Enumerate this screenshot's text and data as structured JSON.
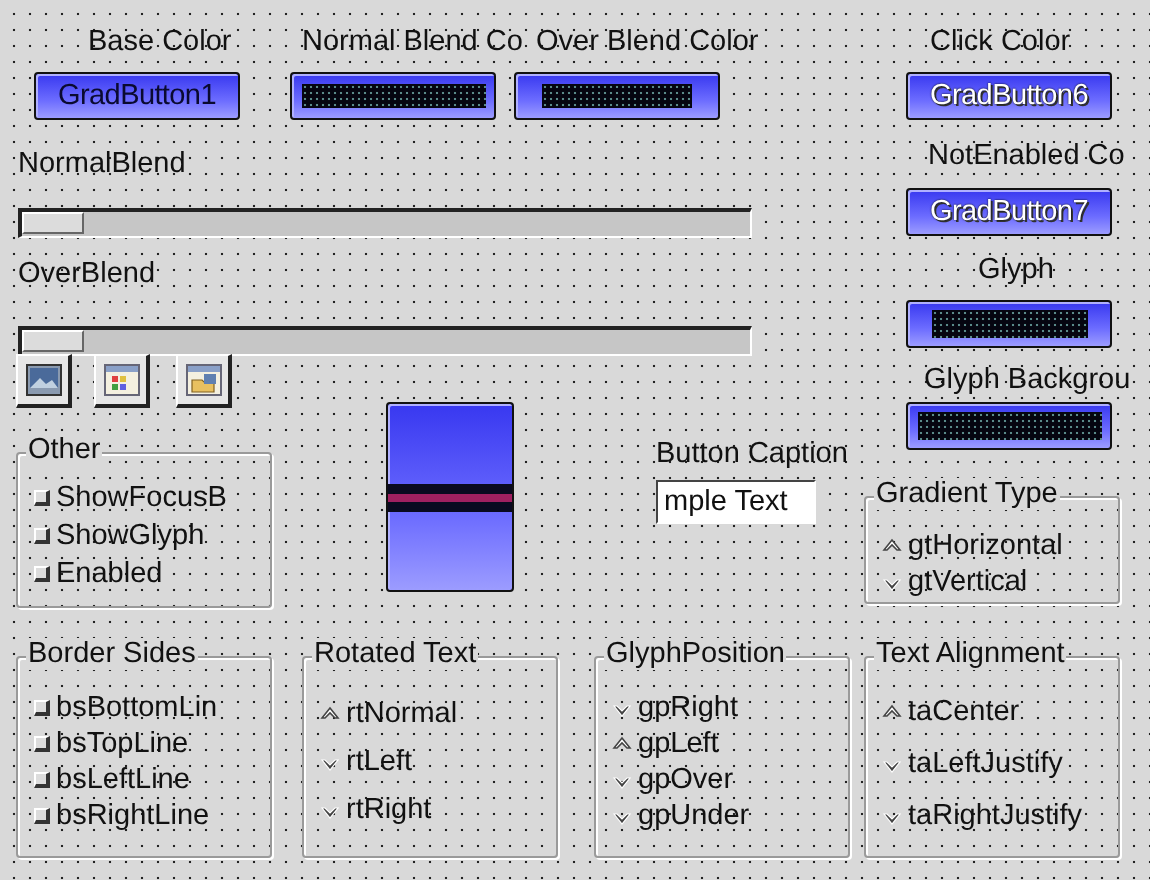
{
  "color_settings": [
    {
      "label": "Base Color",
      "caption": "GradButton1"
    },
    {
      "label": "Normal Blend Co"
    },
    {
      "label": "Over Blend Color"
    },
    {
      "label": "Click Color",
      "caption": "GradButton6"
    },
    {
      "label": "NotEnabled Co",
      "caption": "GradButton7"
    },
    {
      "label": "Glyph"
    },
    {
      "label": "Glyph Backgrou"
    }
  ],
  "sliders": [
    {
      "label": "NormalBlend",
      "level": 0
    },
    {
      "label": "OverBlend",
      "level": 0
    }
  ],
  "caption_field": {
    "label": "Button Caption",
    "value": "mple Text"
  },
  "groups": [
    {
      "title": "Other",
      "kind": "checkbox",
      "items": [
        {
          "label": "ShowFocusB",
          "checked": false
        },
        {
          "label": "ShowGlyph",
          "checked": false
        },
        {
          "label": "Enabled",
          "checked": false
        }
      ]
    },
    {
      "title": "Gradient Type",
      "kind": "radio",
      "items": [
        {
          "label": "gtHorizontal",
          "selected": true
        },
        {
          "label": "gtVertical",
          "selected": false
        }
      ]
    },
    {
      "title": "Border Sides",
      "kind": "checkbox",
      "items": [
        {
          "label": "bsBottomLin",
          "checked": false
        },
        {
          "label": "bsTopLine",
          "checked": false
        },
        {
          "label": "bsLeftLine",
          "checked": false
        },
        {
          "label": "bsRightLine",
          "checked": false
        }
      ]
    },
    {
      "title": "Rotated Text",
      "kind": "radio",
      "items": [
        {
          "label": "rtNormal",
          "selected": true
        },
        {
          "label": "rtLeft",
          "selected": false
        },
        {
          "label": "rtRight",
          "selected": false
        }
      ]
    },
    {
      "title": "GlyphPosition",
      "kind": "radio",
      "items": [
        {
          "label": "gpRight",
          "selected": false
        },
        {
          "label": "gpLeft",
          "selected": true
        },
        {
          "label": "gpOver",
          "selected": false
        },
        {
          "label": "gpUnder",
          "selected": false
        }
      ]
    },
    {
      "title": "Text Alignment",
      "kind": "radio",
      "items": [
        {
          "label": "taCenter",
          "selected": true
        },
        {
          "label": "taLeftJustify",
          "selected": false
        },
        {
          "label": "taRightJustify",
          "selected": false
        }
      ]
    }
  ]
}
